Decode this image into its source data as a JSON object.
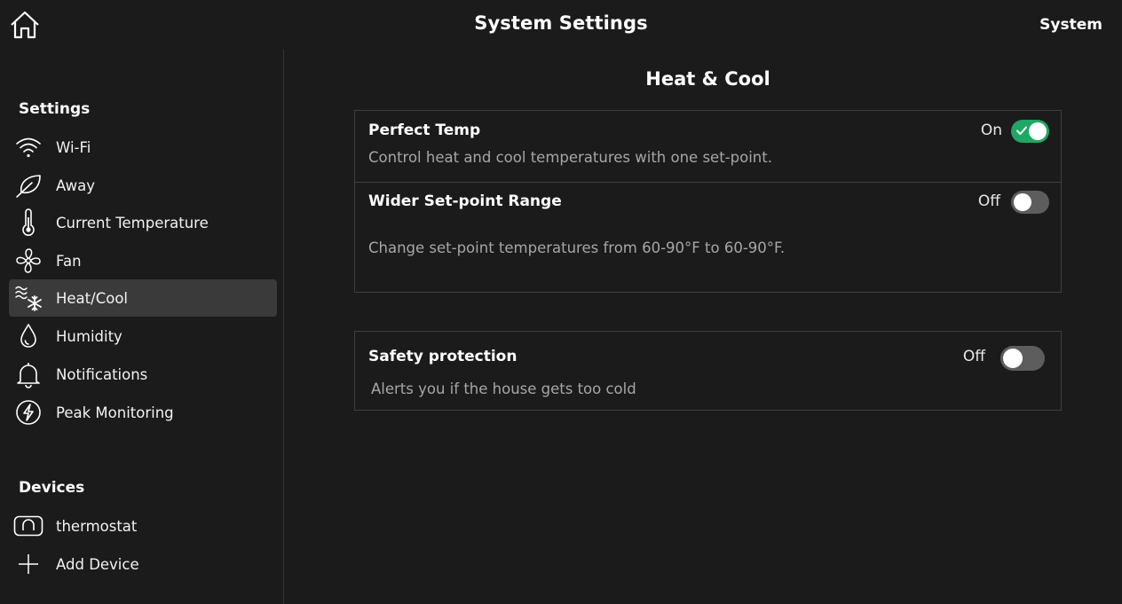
{
  "header": {
    "title": "System Settings",
    "right_label": "System"
  },
  "sidebar": {
    "settings_title": "Settings",
    "items": [
      {
        "label": "Wi-Fi",
        "icon": "wifi-icon"
      },
      {
        "label": "Away",
        "icon": "leaf-icon"
      },
      {
        "label": "Current Temperature",
        "icon": "thermometer-icon"
      },
      {
        "label": "Fan",
        "icon": "fan-icon"
      },
      {
        "label": "Heat/Cool",
        "icon": "heat-cool-icon",
        "active": true
      },
      {
        "label": "Humidity",
        "icon": "droplet-icon"
      },
      {
        "label": "Notifications",
        "icon": "bell-icon"
      },
      {
        "label": "Peak Monitoring",
        "icon": "lightning-icon"
      }
    ],
    "devices_title": "Devices",
    "devices": [
      {
        "label": "thermostat",
        "icon": "thermostat-icon"
      },
      {
        "label": "Add Device",
        "icon": "plus-icon"
      }
    ]
  },
  "main": {
    "heading": "Heat & Cool",
    "card1": {
      "perfect_temp": {
        "title": "Perfect Temp",
        "state": "On",
        "description": "Control heat and cool temperatures with one set-point."
      },
      "wider_range": {
        "title": "Wider Set-point Range",
        "state": "Off",
        "description": "Change set-point temperatures from 60-90°F to 60-90°F."
      }
    },
    "card2": {
      "safety": {
        "title": "Safety protection",
        "state": "Off",
        "description": "Alerts you if the house gets too cold"
      }
    }
  },
  "colors": {
    "background": "#1b1b1b",
    "toggle_on": "#1fa764",
    "toggle_off": "#5d5d5d",
    "active_item": "#3a3a3a"
  }
}
